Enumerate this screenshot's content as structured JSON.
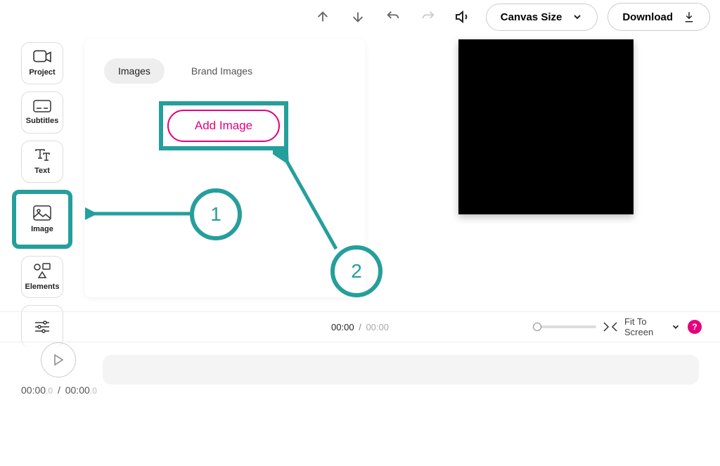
{
  "toolbar": {
    "canvas_size_label": "Canvas Size",
    "download_label": "Download"
  },
  "sidebar": {
    "items": [
      {
        "label": "Project"
      },
      {
        "label": "Subtitles"
      },
      {
        "label": "Text"
      },
      {
        "label": "Image"
      },
      {
        "label": "Elements"
      }
    ]
  },
  "panel": {
    "tabs": [
      {
        "label": "Images"
      },
      {
        "label": "Brand Images"
      }
    ],
    "add_image_label": "Add Image"
  },
  "annotations": {
    "step1": "1",
    "step2": "2"
  },
  "status": {
    "current": "00:00",
    "separator": "/",
    "total": "00:00",
    "fit_label": "Fit To Screen",
    "help": "?"
  },
  "timeline": {
    "current": "00:00",
    "current_dec": ".0",
    "separator": "/",
    "total": "00:00",
    "total_dec": ".0"
  }
}
